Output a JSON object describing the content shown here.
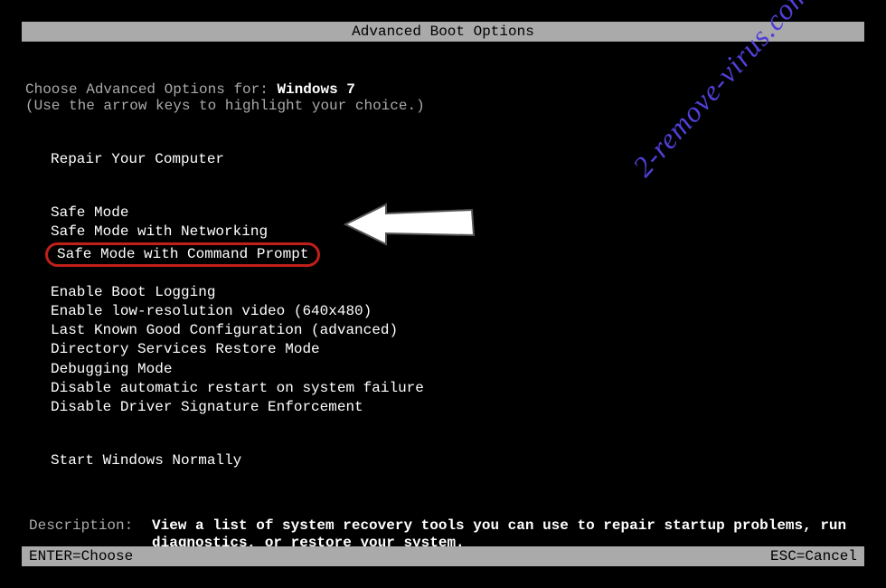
{
  "title": "Advanced Boot Options",
  "choose_prefix": "Choose Advanced Options for: ",
  "os_name": "Windows 7",
  "hint": "(Use the arrow keys to highlight your choice.)",
  "repair_option": "Repair Your Computer",
  "options_group1": [
    "Safe Mode",
    "Safe Mode with Networking",
    "Safe Mode with Command Prompt"
  ],
  "options_group2": [
    "Enable Boot Logging",
    "Enable low-resolution video (640x480)",
    "Last Known Good Configuration (advanced)",
    "Directory Services Restore Mode",
    "Debugging Mode",
    "Disable automatic restart on system failure",
    "Disable Driver Signature Enforcement"
  ],
  "start_normally": "Start Windows Normally",
  "description_label": "Description:",
  "description_text": "View a list of system recovery tools you can use to repair startup problems, run diagnostics, or restore your system.",
  "footer_left": "ENTER=Choose",
  "footer_right": "ESC=Cancel",
  "watermark": "2-remove-virus.com",
  "highlighted_index": 2
}
